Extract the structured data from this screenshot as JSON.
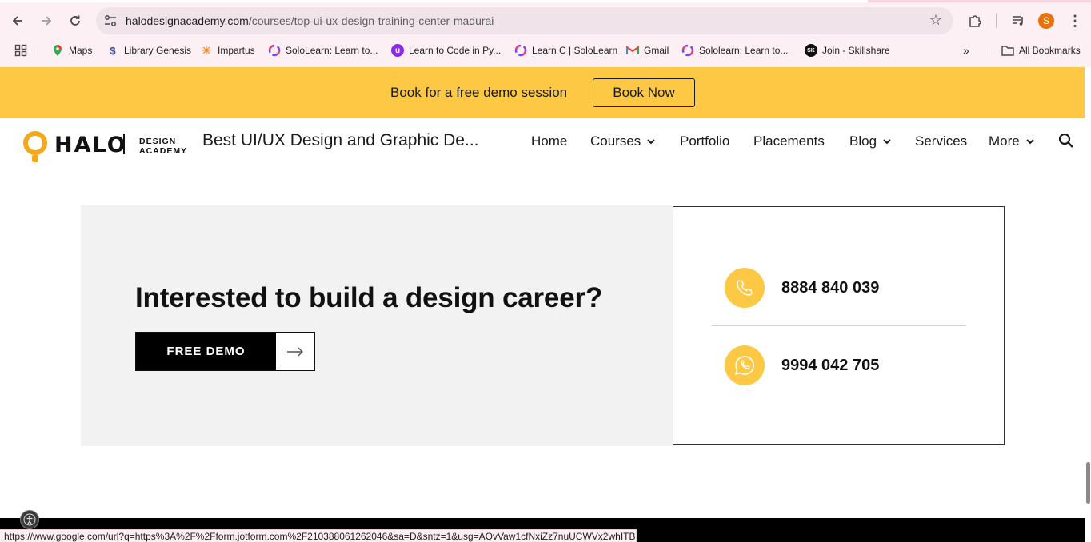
{
  "browser": {
    "url_host": "halodesignacademy.com",
    "url_path": "/courses/top-ui-ux-design-training-center-madurai",
    "profile_initial": "S",
    "bookmarks": [
      {
        "label": "Maps",
        "icon": "maps-icon"
      },
      {
        "label": "Library Genesis",
        "icon": "library-genesis-icon"
      },
      {
        "label": "Impartus",
        "icon": "impartus-icon"
      },
      {
        "label": "SoloLearn: Learn to...",
        "icon": "sololearn-icon"
      },
      {
        "label": "Learn to Code in Py...",
        "icon": "learn-python-icon"
      },
      {
        "label": "Learn C | SoloLearn",
        "icon": "sololearn-icon"
      },
      {
        "label": "Gmail",
        "icon": "gmail-icon"
      },
      {
        "label": "Sololearn: Learn to...",
        "icon": "sololearn-icon"
      },
      {
        "label": "Join - Skillshare",
        "icon": "skillshare-icon"
      }
    ],
    "all_bookmarks": "All Bookmarks",
    "status_url": "https://www.google.com/url?q=https%3A%2F%2Fform.jotform.com%2F210388061262046&sa=D&sntz=1&usg=AOvVaw1cfNxiZz7nuUCWVx2whITB"
  },
  "banner": {
    "text": "Book for a free demo session",
    "button": "Book Now",
    "color": "#fdc844"
  },
  "header": {
    "logo_word": "HALO",
    "logo_sub_1": "DESIGN",
    "logo_sub_2": "ACADEMY",
    "site_title": "Best UI/UX Design and Graphic De...",
    "nav": {
      "home": "Home",
      "courses": "Courses",
      "portfolio": "Portfolio",
      "placements": "Placements",
      "blog": "Blog",
      "services": "Services",
      "more": "More"
    }
  },
  "cta": {
    "heading": "Interested to build a design career?",
    "button": "FREE DEMO"
  },
  "contact": {
    "phone": "8884 840 039",
    "whatsapp": "9994 042 705"
  }
}
